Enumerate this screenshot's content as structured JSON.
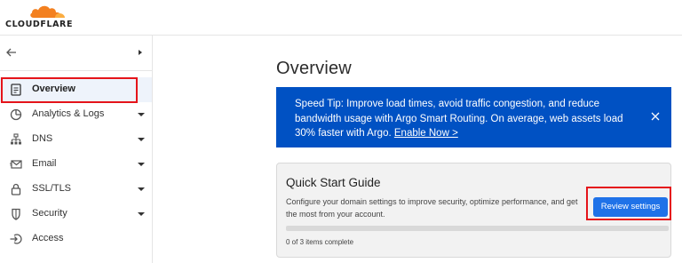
{
  "brand": {
    "logo_text": "CLOUDFLARE",
    "accent": "#f38020"
  },
  "sidebar": {
    "items": [
      {
        "label": "Overview",
        "icon": "document-icon",
        "active": true,
        "has_caret": false
      },
      {
        "label": "Analytics & Logs",
        "icon": "clock-chart-icon",
        "active": false,
        "has_caret": true
      },
      {
        "label": "DNS",
        "icon": "network-icon",
        "active": false,
        "has_caret": true
      },
      {
        "label": "Email",
        "icon": "envelope-icon",
        "active": false,
        "has_caret": true
      },
      {
        "label": "SSL/TLS",
        "icon": "lock-icon",
        "active": false,
        "has_caret": true
      },
      {
        "label": "Security",
        "icon": "shield-icon",
        "active": false,
        "has_caret": true
      },
      {
        "label": "Access",
        "icon": "sign-in-icon",
        "active": false,
        "has_caret": false
      }
    ]
  },
  "main": {
    "title": "Overview",
    "tip": {
      "text": "Speed Tip: Improve load times, avoid traffic congestion, and reduce bandwidth usage with Argo Smart Routing. On average, web assets load 30% faster with Argo.",
      "link": "Enable Now >",
      "background": "#0051c3"
    },
    "quick_start": {
      "title": "Quick Start Guide",
      "description": "Configure your domain settings to improve security, optimize performance, and get the most from your account.",
      "button": "Review settings",
      "progress_fraction": 0,
      "count_text": "0 of 3 items complete"
    }
  }
}
